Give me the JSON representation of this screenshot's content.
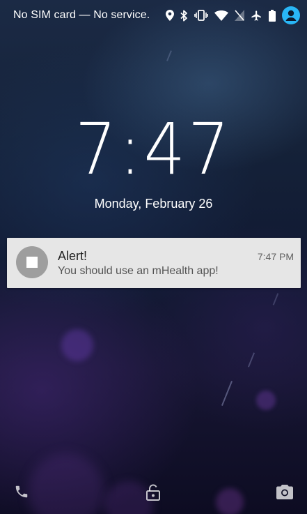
{
  "status_bar": {
    "carrier_text": "No SIM card — No service.",
    "icons": [
      "location-icon",
      "bluetooth-icon",
      "vibrate-icon",
      "wifi-icon",
      "no-sim-icon",
      "airplane-mode-icon",
      "battery-icon",
      "user-avatar-icon"
    ],
    "accent_color": "#29b6f6"
  },
  "lockscreen": {
    "time": "7:47",
    "date": "Monday, February 26"
  },
  "notification": {
    "title": "Alert!",
    "text": "You should use an mHealth app!",
    "time": "7:47 PM",
    "icon": "stop-square-icon",
    "background": "#e6e6e6"
  },
  "bottom_bar": {
    "icons": [
      "phone-icon",
      "lock-icon",
      "camera-icon"
    ]
  }
}
